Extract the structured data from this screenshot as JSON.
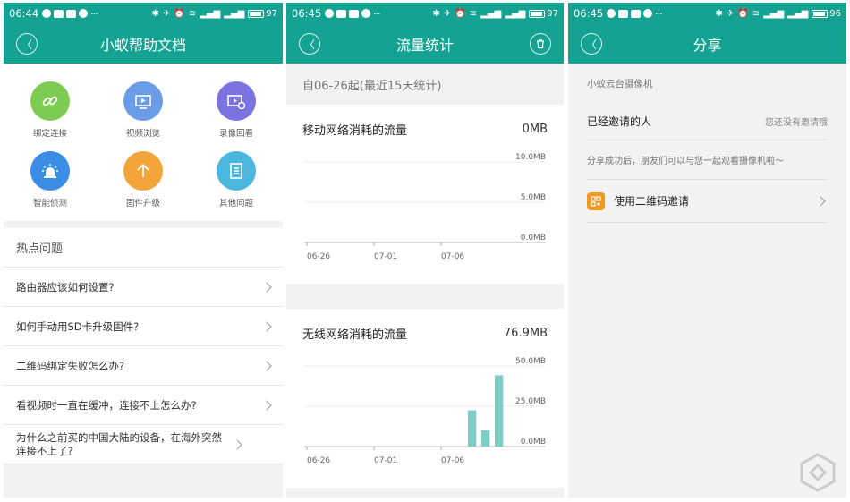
{
  "screens": {
    "help": {
      "status": {
        "time": "06:44",
        "battery": "97"
      },
      "title": "小蚁帮助文档",
      "grid": [
        {
          "label": "绑定连接",
          "icon": "link-icon",
          "color": "#7ccb52"
        },
        {
          "label": "视频浏览",
          "icon": "video-icon",
          "color": "#6a9ce8"
        },
        {
          "label": "录像回看",
          "icon": "playback-icon",
          "color": "#7b73e0"
        },
        {
          "label": "智能侦测",
          "icon": "alarm-icon",
          "color": "#3b8de6"
        },
        {
          "label": "固件升级",
          "icon": "upgrade-icon",
          "color": "#f3a43a"
        },
        {
          "label": "其他问题",
          "icon": "document-icon",
          "color": "#4bb7e0"
        }
      ],
      "hot_title": "热点问题",
      "questions": [
        "路由器应该如何设置?",
        "如何手动用SD卡升级固件?",
        "二维码绑定失败怎么办?",
        "看视频时一直在缓冲，连接不上怎么办?",
        "为什么之前买的中国大陆的设备，在海外突然连接不上了?"
      ]
    },
    "traffic": {
      "status": {
        "time": "06:45",
        "battery": "97"
      },
      "title": "流量统计",
      "since": "自06-26起(最近15天统计)",
      "mobile": {
        "label": "移动网络消耗的流量",
        "total": "0MB"
      },
      "wifi": {
        "label": "无线网络消耗的流量",
        "total": "76.9MB"
      }
    },
    "share": {
      "status": {
        "time": "06:45",
        "battery": "96"
      },
      "title": "分享",
      "device_name": "小蚁云台摄像机",
      "invited_label": "已经邀请的人",
      "invited_status": "您还没有邀请哦",
      "hint": "分享成功后，朋友们可以与您一起观看摄像机啦～",
      "qr_invite": "使用二维码邀请"
    }
  },
  "chart_data": [
    {
      "type": "bar",
      "title": "移动网络消耗的流量",
      "x_ticks": [
        "06-26",
        "07-01",
        "07-06"
      ],
      "y_ticks": [
        "10.0MB",
        "5.0MB",
        "0.0MB"
      ],
      "ylim": [
        0,
        10
      ],
      "unit": "MB",
      "categories": [
        "06-26",
        "06-27",
        "06-28",
        "06-29",
        "06-30",
        "07-01",
        "07-02",
        "07-03",
        "07-04",
        "07-05",
        "07-06",
        "07-07",
        "07-08",
        "07-09",
        "07-10"
      ],
      "values": [
        0,
        0,
        0,
        0,
        0,
        0,
        0,
        0,
        0,
        0,
        0,
        0,
        0,
        0,
        0
      ],
      "color": "#7ccfc6"
    },
    {
      "type": "bar",
      "title": "无线网络消耗的流量",
      "x_ticks": [
        "06-26",
        "07-01",
        "07-06"
      ],
      "y_ticks": [
        "50.0MB",
        "25.0MB",
        "0.0MB"
      ],
      "ylim": [
        0,
        50
      ],
      "unit": "MB",
      "categories": [
        "06-26",
        "06-27",
        "06-28",
        "06-29",
        "06-30",
        "07-01",
        "07-02",
        "07-03",
        "07-04",
        "07-05",
        "07-06",
        "07-07",
        "07-08",
        "07-09",
        "07-10"
      ],
      "values": [
        0,
        0,
        0,
        0,
        0,
        0,
        0,
        0,
        0,
        0,
        0,
        0,
        22.5,
        10.2,
        44.2
      ],
      "color": "#7ccfc6"
    }
  ],
  "colors": {
    "primary": "#14a292",
    "bg": "#f2f2f2"
  }
}
